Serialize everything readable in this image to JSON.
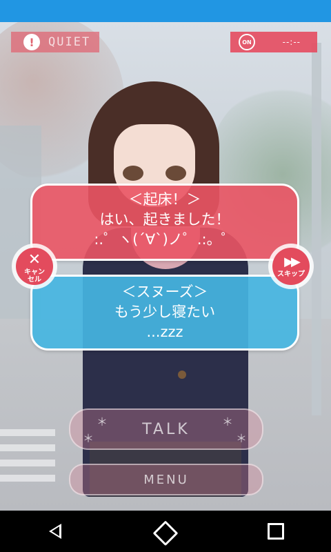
{
  "top_left": {
    "icon": "info-icon",
    "glyph": "!",
    "label": "QUIET"
  },
  "top_right": {
    "icon": "alarm-clock-icon",
    "status": "ON",
    "time": "--:--"
  },
  "wake_option": {
    "line1": "＜起床！＞",
    "line2": "はい、起きました！",
    "line3": ":.゜ヽ(´∀`)ノ゜.:。゜"
  },
  "snooze_option": {
    "line1": "＜スヌーズ＞",
    "line2": "もう少し寝たい",
    "line3": "...zzz"
  },
  "cancel": {
    "icon": "close-icon",
    "glyph": "✕",
    "label_line1": "キャン",
    "label_line2": "セル"
  },
  "skip": {
    "icon": "fast-forward-icon",
    "glyph": "▶▶",
    "label": "スキップ"
  },
  "talk": {
    "label": "TALK",
    "sparkle": "＊"
  },
  "menu": {
    "label": "MENU"
  },
  "colors": {
    "status_bar": "#2196e3",
    "accent_red": "#e34b5d",
    "bubble_blue": "#45b5e1"
  }
}
